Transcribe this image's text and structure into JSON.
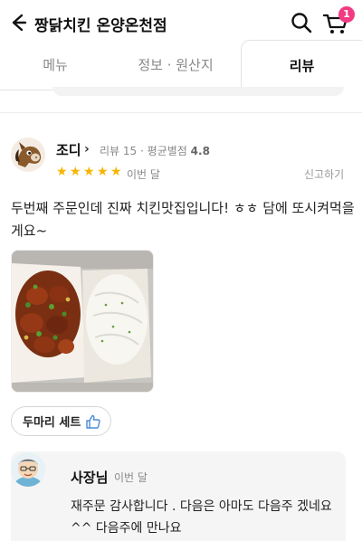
{
  "header": {
    "title": "짱닭치킨 온양온천점",
    "cart_count": "1",
    "icons": [
      "back-arrow-icon",
      "search-icon",
      "cart-icon"
    ]
  },
  "tabs": [
    {
      "label": "메뉴"
    },
    {
      "label": "정보 · 원산지"
    },
    {
      "label": "리뷰",
      "active": true
    }
  ],
  "review": {
    "reviewer_name": "조디",
    "chevron": "›",
    "review_count_label": "리뷰 15",
    "separator": "·",
    "avg_rating_label": "평균별점",
    "avg_rating_value": "4.8",
    "rating": 5,
    "date": "이번 달",
    "report_label": "신고하기",
    "text": "두번째 주문인데 진짜 치킨맛집입니다! ㅎㅎ 담에 또시켜먹을게요~",
    "menu_tag": "두마리 세트"
  },
  "owner_reply": {
    "name": "사장님",
    "date": "이번 달",
    "text": "재주문 감사합니다 . 다음은 아마도 다음주 겠네요 ^^ 다음주에 만나요"
  },
  "colors": {
    "accent_badge": "#f23a82",
    "star": "#f7b500"
  }
}
